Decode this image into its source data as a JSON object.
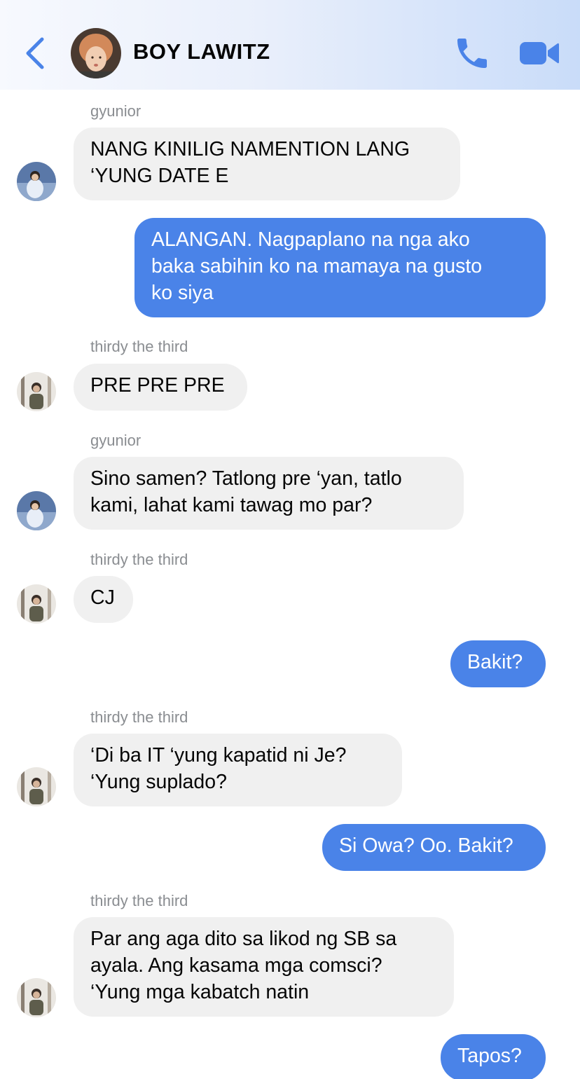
{
  "header": {
    "title": "BOY LAWITZ",
    "back_icon": "chevron-left-icon",
    "call_icon": "phone-icon",
    "video_icon": "video-camera-icon",
    "accent_color": "#4a83e8"
  },
  "messages": [
    {
      "sender": "gyunior",
      "direction": "in",
      "lines": [
        "NANG KINILIG NAMENTION LANG",
        "‘YUNG DATE E"
      ]
    },
    {
      "direction": "out",
      "lines": [
        "ALANGAN. Nagpaplano na nga ako",
        "baka sabihin ko na mamaya na gusto",
        "ko siya"
      ]
    },
    {
      "sender": "thirdy the third",
      "direction": "in",
      "lines": [
        "PRE PRE PRE"
      ]
    },
    {
      "sender": "gyunior",
      "direction": "in",
      "lines": [
        "Sino samen? Tatlong pre ‘yan, tatlo",
        "kami, lahat kami tawag mo par?"
      ]
    },
    {
      "sender": "thirdy the third",
      "direction": "in",
      "lines": [
        "CJ"
      ]
    },
    {
      "direction": "out",
      "lines": [
        "Bakit?"
      ]
    },
    {
      "sender": "thirdy the third",
      "direction": "in",
      "lines": [
        "‘Di ba IT ‘yung kapatid ni Je?",
        "‘Yung suplado?"
      ]
    },
    {
      "direction": "out",
      "lines": [
        "Si Owa? Oo. Bakit?"
      ]
    },
    {
      "sender": "thirdy the third",
      "direction": "in",
      "lines": [
        "Par ang aga dito sa likod ng SB sa",
        "ayala. Ang kasama mga comsci?",
        "‘Yung mga kabatch natin"
      ]
    },
    {
      "direction": "out",
      "lines": [
        "Tapos?"
      ]
    }
  ]
}
